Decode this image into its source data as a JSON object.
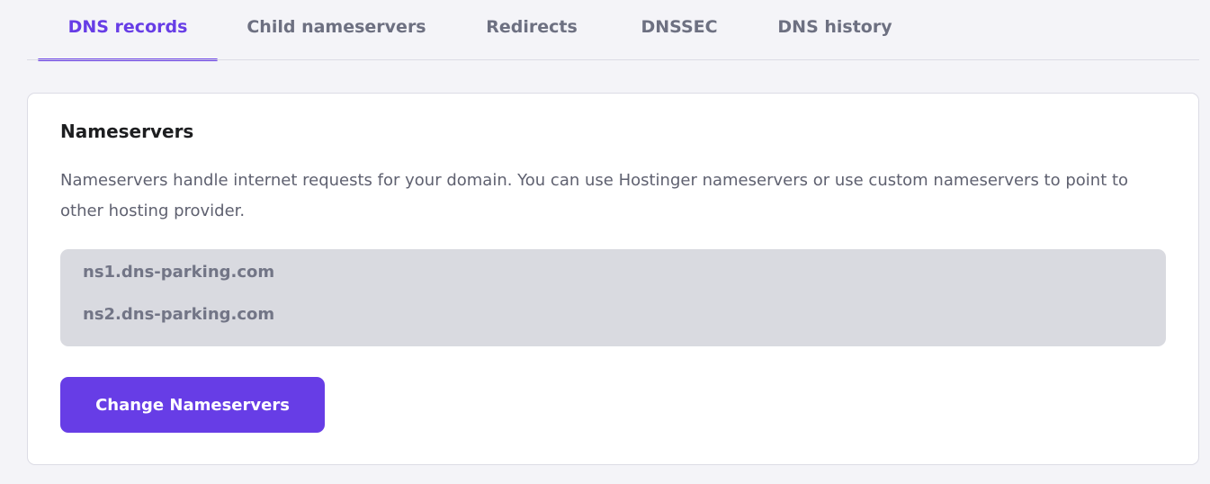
{
  "tabs": [
    {
      "label": "DNS records",
      "active": true
    },
    {
      "label": "Child nameservers",
      "active": false
    },
    {
      "label": "Redirects",
      "active": false
    },
    {
      "label": "DNSSEC",
      "active": false
    },
    {
      "label": "DNS history",
      "active": false
    }
  ],
  "nameservers": {
    "title": "Nameservers",
    "description": "Nameservers handle internet requests for your domain. You can use Hostinger nameservers or use custom nameservers to point to other hosting provider.",
    "list": [
      "ns1.dns-parking.com",
      "ns2.dns-parking.com"
    ],
    "button_label": "Change Nameservers"
  },
  "colors": {
    "accent": "#673de6",
    "page_background": "#f4f4f8",
    "card_background": "#ffffff",
    "nameserver_box": "#d9dae0",
    "muted_text": "#727586"
  }
}
